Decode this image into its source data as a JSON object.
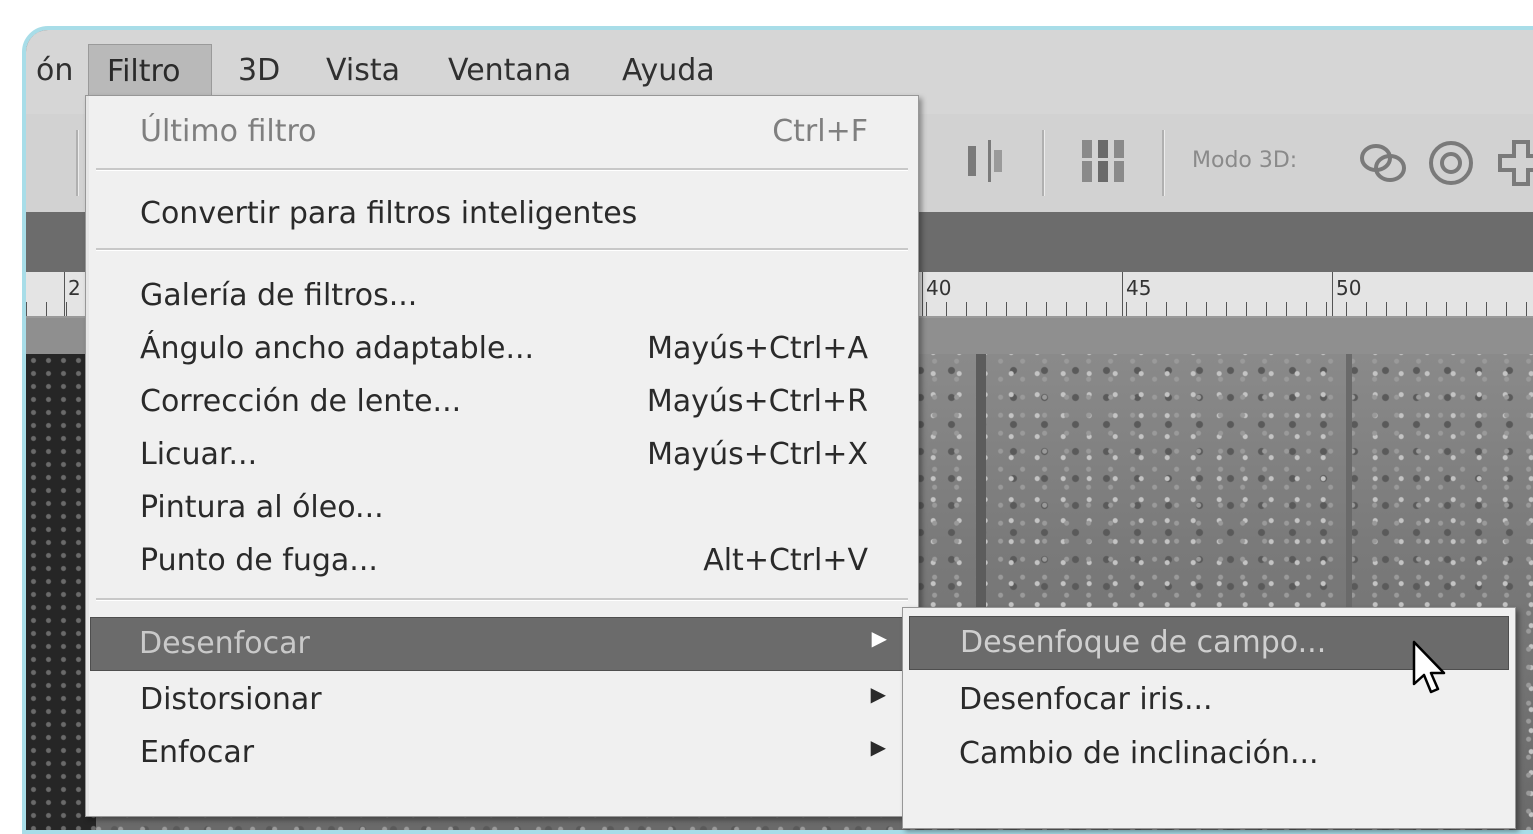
{
  "menubar": {
    "items": [
      {
        "label": "ón",
        "active": false
      },
      {
        "label": "Filtro",
        "active": true
      },
      {
        "label": "3D",
        "active": false
      },
      {
        "label": "Vista",
        "active": false
      },
      {
        "label": "Ventana",
        "active": false
      },
      {
        "label": "Ayuda",
        "active": false
      }
    ]
  },
  "optionsbar": {
    "modo_3d_label": "Modo 3D:",
    "icons": [
      "distribute-icon",
      "align-columns-icon",
      "rotate-3d-icon",
      "roll-3d-icon",
      "pan-3d-icon"
    ]
  },
  "ruler": {
    "labels": [
      "2",
      "40",
      "45",
      "50"
    ]
  },
  "filter_menu": {
    "items": [
      {
        "label": "Último filtro",
        "shortcut": "Ctrl+F",
        "disabled": true
      },
      {
        "label": "Convertir para filtros inteligentes",
        "shortcut": ""
      },
      {
        "label": "Galería de filtros...",
        "shortcut": ""
      },
      {
        "label": "Ángulo ancho adaptable...",
        "shortcut": "Mayús+Ctrl+A"
      },
      {
        "label": "Corrección de lente...",
        "shortcut": "Mayús+Ctrl+R"
      },
      {
        "label": "Licuar...",
        "shortcut": "Mayús+Ctrl+X"
      },
      {
        "label": "Pintura al óleo...",
        "shortcut": ""
      },
      {
        "label": "Punto de fuga...",
        "shortcut": "Alt+Ctrl+V"
      },
      {
        "label": "Desenfocar",
        "submenu": true,
        "highlighted": true
      },
      {
        "label": "Distorsionar",
        "submenu": true
      },
      {
        "label": "Enfocar",
        "submenu": true
      }
    ]
  },
  "blur_submenu": {
    "items": [
      {
        "label": "Desenfoque de campo...",
        "highlighted": true
      },
      {
        "label": "Desenfocar iris..."
      },
      {
        "label": "Cambio de inclinación..."
      }
    ]
  },
  "colors": {
    "accent_border": "#a8dde8",
    "highlight": "#6b6b6b",
    "menu_bg": "#f0f0f0"
  }
}
